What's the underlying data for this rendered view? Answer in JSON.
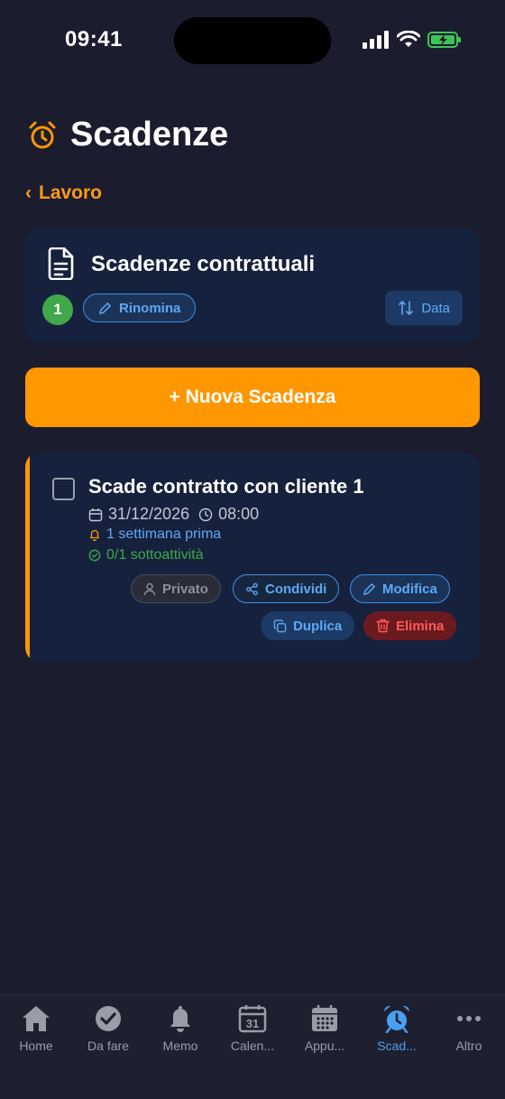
{
  "status_bar": {
    "time": "09:41"
  },
  "header": {
    "title": "Scadenze",
    "icon": "alarm-clock-icon"
  },
  "back_link": {
    "label": "Lavoro"
  },
  "list_card": {
    "title": "Scadenze contrattuali",
    "count": "1",
    "rename_label": "Rinomina",
    "sort_label": "Data"
  },
  "new_button": {
    "label": "+ Nuova Scadenza"
  },
  "task": {
    "title": "Scade contratto con cliente 1",
    "date": "31/12/2026",
    "time": "08:00",
    "reminder": "1 settimana prima",
    "subtasks": "0/1 sottoattività",
    "actions": {
      "private": "Privato",
      "share": "Condividi",
      "edit": "Modifica",
      "duplicate": "Duplica",
      "delete": "Elimina"
    }
  },
  "tab_bar": {
    "tabs": [
      {
        "label": "Home",
        "icon": "home-icon"
      },
      {
        "label": "Da fare",
        "icon": "check-circle-icon"
      },
      {
        "label": "Memo",
        "icon": "bell-icon"
      },
      {
        "label": "Calen...",
        "icon": "calendar-icon"
      },
      {
        "label": "Appu...",
        "icon": "calendar-grid-icon"
      },
      {
        "label": "Scad...",
        "icon": "alarm-clock-icon"
      },
      {
        "label": "Altro",
        "icon": "more-icon"
      }
    ],
    "active_index": 5
  },
  "colors": {
    "background": "#1b1c2e",
    "card": "#16213d",
    "accent": "#ff9700",
    "blue": "#4a9ff0",
    "green": "#40a84a",
    "red": "#ff5b5b"
  }
}
